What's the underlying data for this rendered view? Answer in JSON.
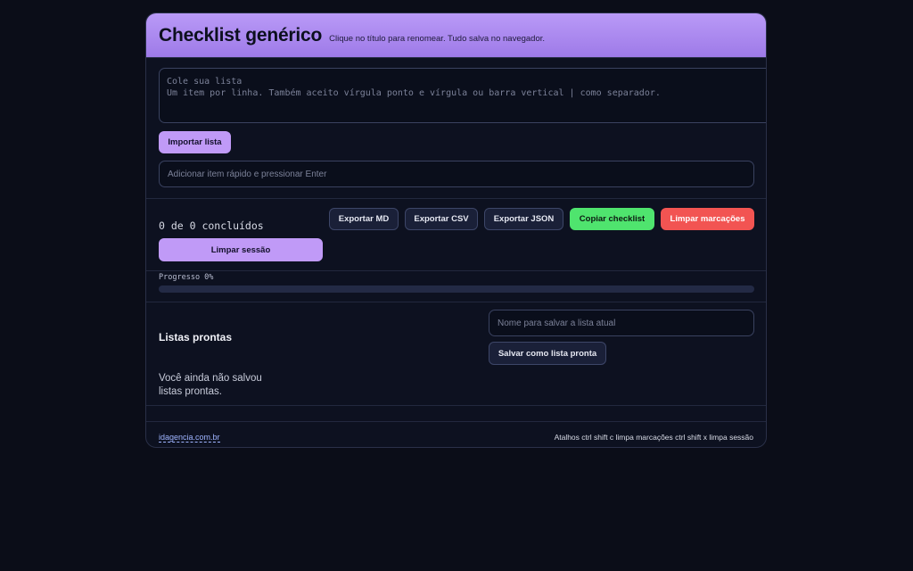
{
  "header": {
    "title": "Checklist genérico",
    "subtitle": "Clique no título para renomear. Tudo salva no navegador."
  },
  "import": {
    "textarea_placeholder": "Cole sua lista\nUm item por linha. Também aceito vírgula ponto e vírgula ou barra vertical | como separador.",
    "import_button": "Importar lista",
    "quick_add_placeholder": "Adicionar item rápido e pressionar Enter"
  },
  "status": {
    "count_text": "0 de 0 concluídos",
    "buttons": {
      "export_md": "Exportar MD",
      "export_csv": "Exportar CSV",
      "export_json": "Exportar JSON",
      "copy": "Copiar checklist",
      "clear_marks": "Limpar marcações",
      "clear_session": "Limpar sessão"
    }
  },
  "progress": {
    "label": "Progresso 0%",
    "value": 0
  },
  "ready_lists": {
    "title": "Listas prontas",
    "empty_text": "Você ainda não salvou listas prontas.",
    "name_placeholder": "Nome para salvar a lista atual",
    "save_button": "Salvar como lista pronta"
  },
  "footer": {
    "link": "idagencia.com.br",
    "shortcuts": "Atalhos ctrl shift c limpa marcações ctrl shift x limpa sessão"
  },
  "colors": {
    "accent": "#b99af7",
    "success": "#4fe46e",
    "danger": "#f25452",
    "background": "#0b0d18"
  }
}
